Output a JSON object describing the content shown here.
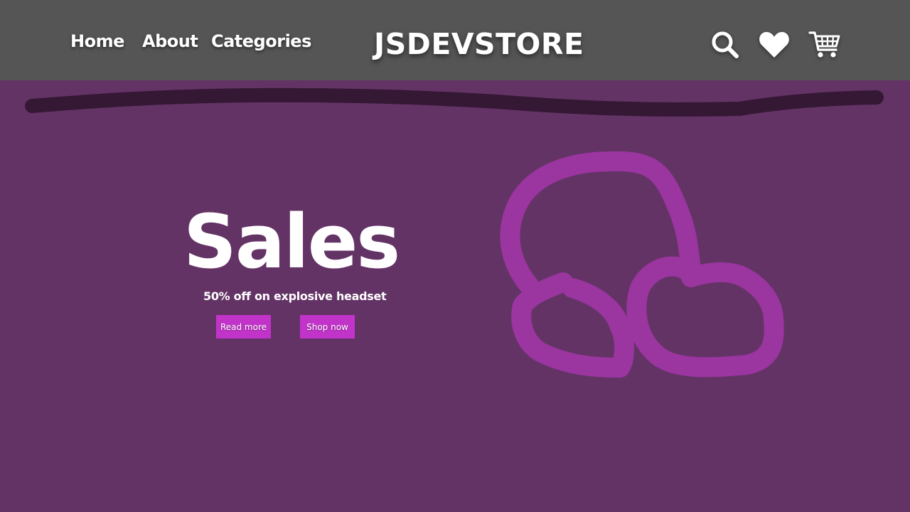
{
  "nav": {
    "links": [
      {
        "label": "Home"
      },
      {
        "label": "About"
      },
      {
        "label": "Categories"
      }
    ],
    "brand": "JSDEVSTORE",
    "icons": [
      "search-icon",
      "heart-icon",
      "cart-icon"
    ]
  },
  "hero": {
    "title": "Sales",
    "subtitle": "50% off on explosive headset",
    "buttons": {
      "read_more": "Read more",
      "shop_now": "Shop now"
    },
    "illustration": "headset-doodle"
  },
  "colors": {
    "navbar": "#555555",
    "background": "#643366",
    "accent_button": "#c234c9",
    "headset_stroke": "#9b35a0",
    "scribble": "#341834",
    "text": "#ffffff"
  }
}
